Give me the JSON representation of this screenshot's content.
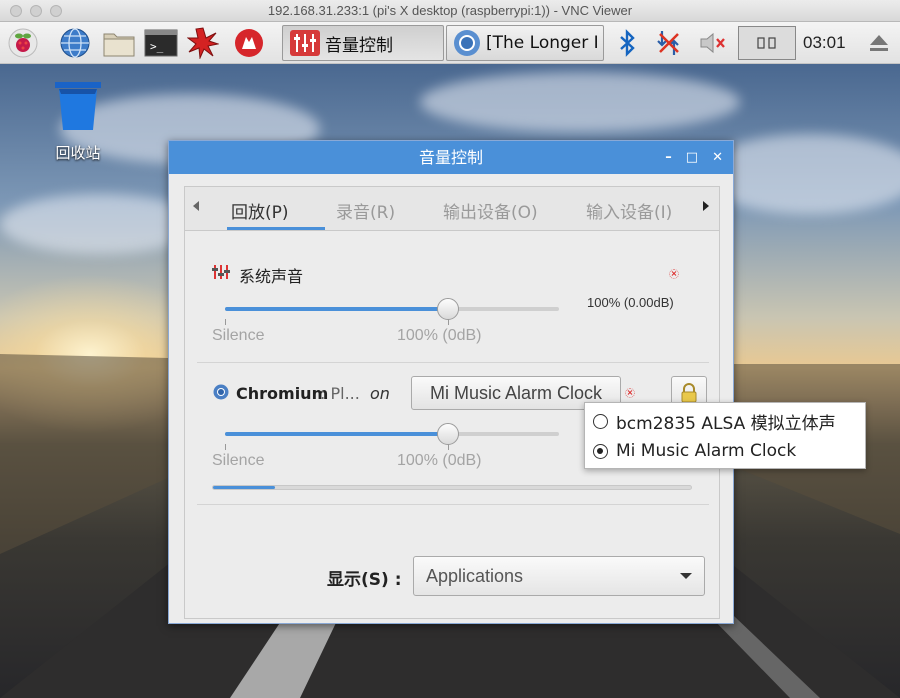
{
  "window": {
    "title": "192.168.31.233:1 (pi's X desktop (raspberrypi:1)) - VNC Viewer"
  },
  "panel": {
    "icons": [
      "raspberry-menu-icon",
      "web-browser-icon",
      "file-manager-icon",
      "terminal-icon",
      "burst-app-icon",
      "wolfram-icon"
    ],
    "tasks": [
      {
        "label": "音量控制",
        "icon": "mixer-icon"
      },
      {
        "label": "[The Longer I ...",
        "icon": "chromium-icon"
      }
    ],
    "tray": [
      "bluetooth-icon",
      "network-disconnected-icon",
      "volume-muted-icon",
      "cpu-monitor-icon"
    ],
    "clock": "03:01",
    "eject_icon": "eject-icon"
  },
  "desktop": {
    "trash_label": "回收站"
  },
  "dialog": {
    "title": "音量控制",
    "controls": {
      "minimize": "–",
      "maximize": "□",
      "close": "✕"
    },
    "tabs": [
      {
        "label": "回放(P)",
        "active": true
      },
      {
        "label": "录音(R)",
        "active": false
      },
      {
        "label": "输出设备(O)",
        "active": false
      },
      {
        "label": "输入设备(I)",
        "active": false
      }
    ],
    "system": {
      "title": "系统声音",
      "volume_text": "100% (0.00dB)",
      "volume": 100,
      "silence_label": "Silence",
      "mark_label": "100% (0dB)"
    },
    "stream": {
      "app_name": "Chromium",
      "app_suffix": " : Pl...",
      "on_label": "on",
      "device": "Mi Music Alarm Clock",
      "volume": 100,
      "silence_label": "Silence",
      "mark_label": "100% (0dB)",
      "level": 13
    },
    "show": {
      "label": "显示(S) :",
      "value": "Applications"
    }
  },
  "popup": {
    "options": [
      {
        "label": "bcm2835 ALSA 模拟立体声",
        "selected": false
      },
      {
        "label": "Mi Music Alarm Clock",
        "selected": true
      }
    ]
  },
  "colors": {
    "accent": "#4a90d9",
    "mute": "#dd2222"
  }
}
